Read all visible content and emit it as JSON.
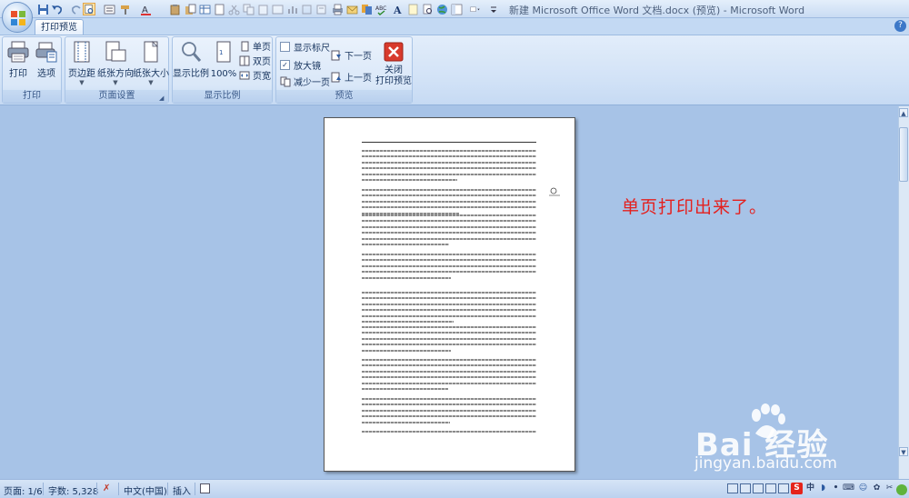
{
  "window": {
    "title": "新建 Microsoft Office Word 文档.docx (预览) - Microsoft Word"
  },
  "quick_access": {
    "icons": [
      "save-icon",
      "undo-icon",
      "redo-icon",
      "print-preview-icon",
      "format-painter-icon",
      "font-color-icon",
      "clipboard-icon",
      "table-icon",
      "spell-check-icon",
      "bold-a-icon",
      "find-icon",
      "globe-icon",
      "customize-icon"
    ]
  },
  "tabs": [
    {
      "label": "打印预览"
    }
  ],
  "ribbon": {
    "print_group": {
      "label": "打印",
      "print": "打印",
      "options": "选项"
    },
    "page_setup_group": {
      "label": "页面设置",
      "margins": "页边距",
      "orientation": "纸张方向",
      "size": "纸张大小"
    },
    "zoom_group": {
      "label": "显示比例",
      "zoom": "显示比例",
      "hundred": "100%",
      "one_page": "单页",
      "two_pages": "双页",
      "page_width": "页宽"
    },
    "preview_group": {
      "label": "预览",
      "show_ruler": "显示标尺",
      "show_ruler_checked": false,
      "magnifier": "放大镜",
      "magnifier_checked": true,
      "shrink_one_page": "减少一页",
      "next_page": "下一页",
      "prev_page": "上一页",
      "close_line1": "关闭",
      "close_line2": "打印预览"
    }
  },
  "annotation": "单页打印出来了。",
  "watermark": {
    "brand": "Bai  经验",
    "url": "jingyan.baidu.com"
  },
  "statusbar": {
    "page": "页面: 1/6",
    "words": "字数: 5,328",
    "language": "中文(中国)",
    "insert": "插入"
  },
  "colors": {
    "workspace": "#a7c3e7",
    "annotation": "#e4201e",
    "close_button": "#d83a2c"
  }
}
